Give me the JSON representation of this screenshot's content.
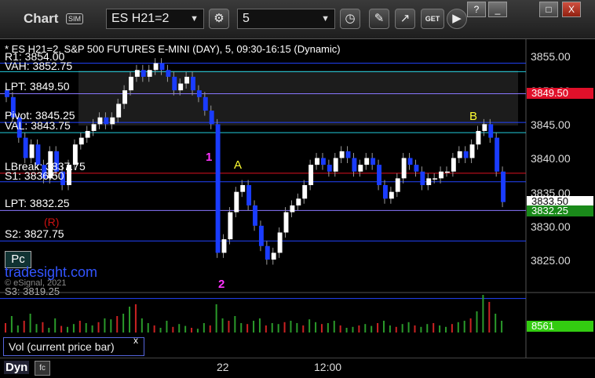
{
  "toolbar": {
    "title": "Chart",
    "sim_badge": "SIM",
    "symbol": "ES H21=2",
    "interval": "5",
    "get_label": "GET",
    "icons": [
      "settings-gear-icon",
      "clock-icon",
      "pencil-icon",
      "study-icon",
      "get-icon",
      "play-icon",
      "help-icon",
      "minimize-icon",
      "maximize-icon",
      "close-icon"
    ],
    "window_buttons": [
      "?",
      "_",
      "□",
      "X"
    ]
  },
  "chart_header": "* ES H21=2, S&P 500 FUTURES E-MINI (DAY), 5, 09:30-16:15 (Dynamic)",
  "price_axis": [
    "3855.00",
    "3850.00",
    "3845.00",
    "3840.00",
    "3835.00",
    "3830.00",
    "3825.00"
  ],
  "price_tags": [
    {
      "text": "3849.50",
      "price": 3849.5,
      "bg": "#e0102a",
      "fg": "#ffffff"
    },
    {
      "text": "3833.50",
      "price": 3833.5,
      "bg": "#ffffff",
      "fg": "#000000"
    },
    {
      "text": "3832.25",
      "price": 3832.25,
      "bg": "#1a8a1a",
      "fg": "#ffffff"
    }
  ],
  "level_lines": [
    {
      "label": "R1: 3854.00",
      "price": 3854.0,
      "color": "#2244ff"
    },
    {
      "label": "VAH: 3852.75",
      "price": 3852.75,
      "color": "#22ccdd"
    },
    {
      "label": "LPT: 3849.50",
      "price": 3849.5,
      "color": "#8877ff"
    },
    {
      "label": "Pivot: 3845.25",
      "price": 3845.25,
      "color": "#2244ff"
    },
    {
      "label": "VAL: 3843.75",
      "price": 3843.75,
      "color": "#22ccdd"
    },
    {
      "label": "LBreak: 3837.75",
      "price": 3837.75,
      "color": "#dd1122"
    },
    {
      "label": "S1: 3836.50",
      "price": 3836.5,
      "color": "#2244ff"
    },
    {
      "label": "LPT: 3832.25",
      "price": 3832.25,
      "color": "#8877ff"
    },
    {
      "label": "S2: 3827.75",
      "price": 3827.75,
      "color": "#2244ff"
    },
    {
      "label": "S3: 3819.25",
      "price": 3819.25,
      "color": "#2244ff"
    }
  ],
  "annotations": [
    {
      "text": "(R)",
      "color": "#cc1111"
    },
    {
      "text": "Pc",
      "color": "#ffffff"
    },
    {
      "text": "tradesight.com",
      "color": "#3355ff"
    },
    {
      "text": "© eSignal, 2021",
      "color": "#888888"
    },
    {
      "text": "A",
      "color": "#ffff33"
    },
    {
      "text": "B",
      "color": "#ffff33"
    },
    {
      "text": "1",
      "color": "#ff33ff"
    },
    {
      "text": "2",
      "color": "#ff33ff"
    }
  ],
  "vol_panel": {
    "label": "Vol (current price bar)",
    "close_icon": "x",
    "value": "8561",
    "value_bg": "#33cc11"
  },
  "time_axis": [
    "22",
    "12:00"
  ],
  "bottom": {
    "dyn": "Dyn",
    "icon": "fc-icon"
  },
  "chart_data": {
    "type": "candlestick",
    "series": [
      {
        "name": "ES H21=2",
        "closes": [
          3849,
          3846,
          3843,
          3840,
          3842,
          3839,
          3837,
          3841,
          3838,
          3836,
          3839,
          3842,
          3843,
          3844,
          3845,
          3846,
          3845,
          3846,
          3848,
          3850,
          3852,
          3853,
          3852,
          3853,
          3854,
          3853,
          3852,
          3850,
          3851,
          3852,
          3850,
          3849,
          3847,
          3845,
          3826,
          3828,
          3832,
          3835,
          3836,
          3833,
          3830,
          3827,
          3825,
          3826,
          3829,
          3832,
          3833,
          3834,
          3836,
          3839,
          3840,
          3839,
          3838,
          3840,
          3841,
          3840,
          3838,
          3839,
          3840,
          3839,
          3836,
          3834,
          3835,
          3837,
          3840,
          3839,
          3838,
          3836,
          3837,
          3837,
          3838,
          3838,
          3840,
          3841,
          3840,
          3842,
          3844,
          3845,
          3843,
          3838,
          3833.5
        ]
      }
    ],
    "volumes": [
      20,
      35,
      15,
      25,
      40,
      18,
      22,
      10,
      30,
      14,
      12,
      18,
      25,
      20,
      15,
      22,
      30,
      28,
      35,
      40,
      55,
      60,
      30,
      20,
      15,
      10,
      25,
      12,
      18,
      14,
      10,
      8,
      20,
      15,
      60,
      30,
      25,
      35,
      20,
      18,
      25,
      30,
      15,
      20,
      18,
      22,
      25,
      20,
      15,
      28,
      22,
      18,
      20,
      25,
      15,
      10,
      12,
      15,
      18,
      14,
      20,
      25,
      15,
      12,
      18,
      22,
      15,
      12,
      18,
      20,
      15,
      12,
      18,
      22,
      25,
      30,
      45,
      80,
      65,
      40,
      25
    ]
  }
}
